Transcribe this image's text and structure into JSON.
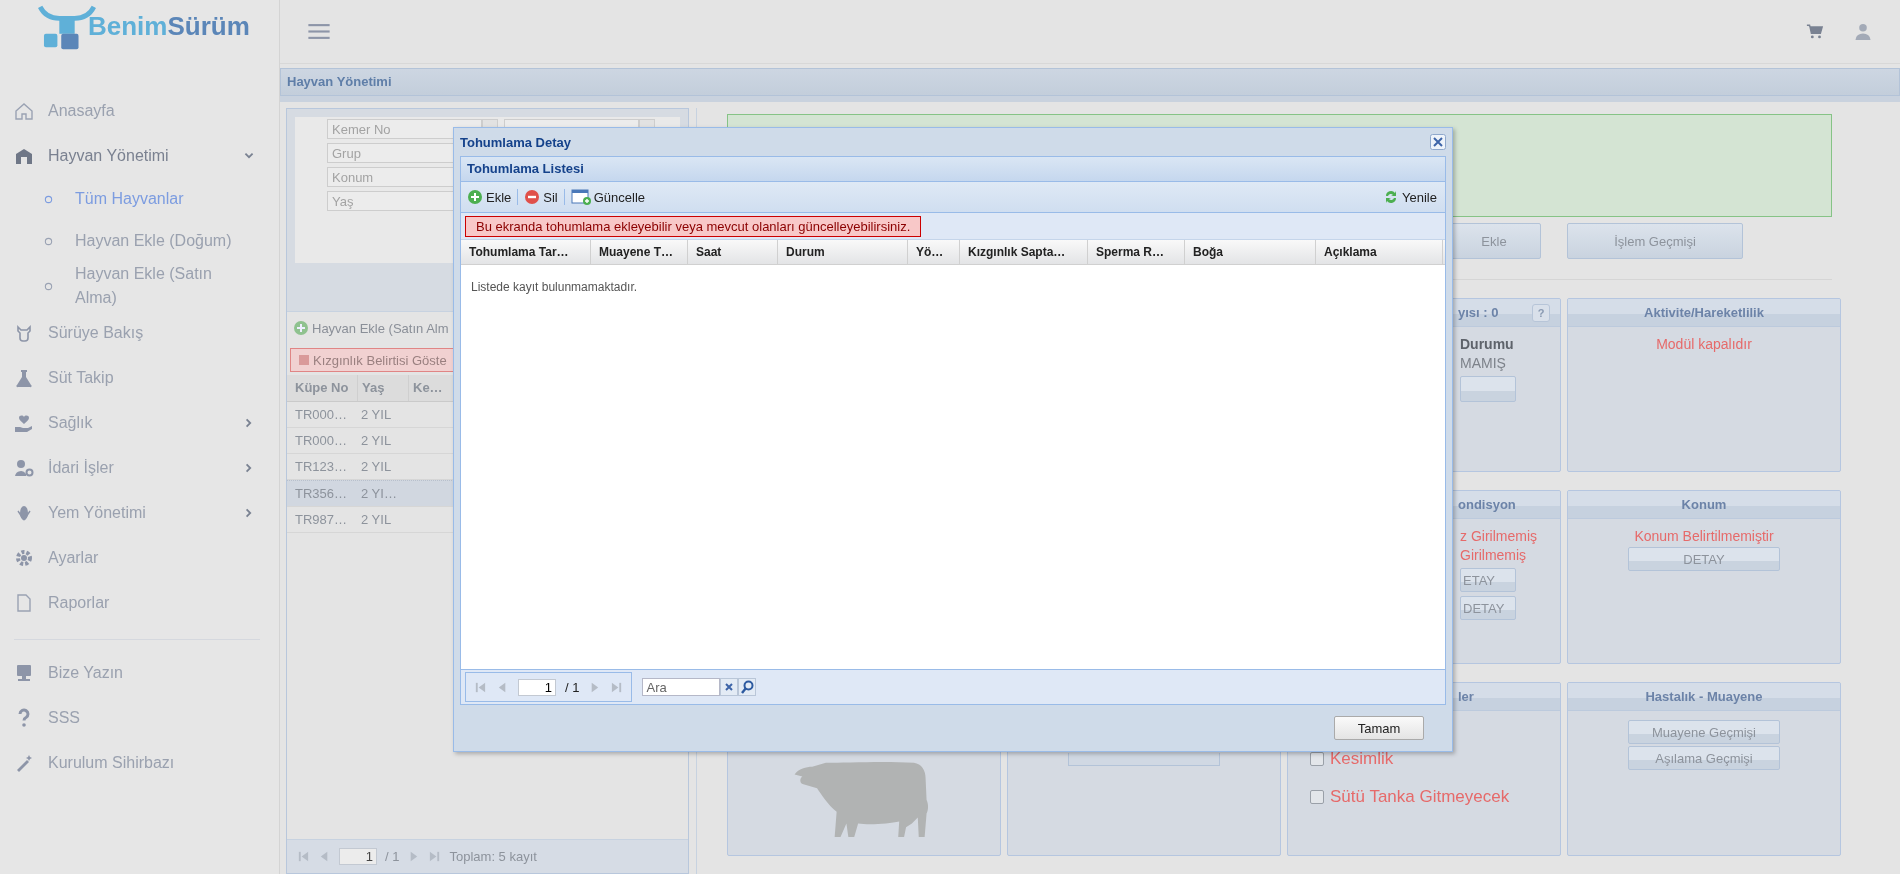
{
  "logo": {
    "parts": [
      "Benim",
      "Sürüm"
    ]
  },
  "sidebar": {
    "items": [
      {
        "label": "Anasayfa"
      },
      {
        "label": "Hayvan Yönetimi",
        "expanded": true,
        "children": [
          {
            "label": "Tüm Hayvanlar",
            "selected": true
          },
          {
            "label": "Hayvan Ekle (Doğum)",
            "selected": false
          },
          {
            "label": "Hayvan Ekle (Satın Alma)",
            "selected": false
          }
        ]
      },
      {
        "label": "Sürüye Bakış"
      },
      {
        "label": "Süt Takip"
      },
      {
        "label": "Sağlık",
        "expanded": false
      },
      {
        "label": "İdari İşler",
        "expanded": false
      },
      {
        "label": "Yem Yönetimi",
        "expanded": false
      },
      {
        "label": "Ayarlar"
      },
      {
        "label": "Raporlar"
      }
    ],
    "footer_items": [
      {
        "label": "Bize Yazın"
      },
      {
        "label": "SSS"
      },
      {
        "label": "Kurulum Sihirbazı"
      }
    ]
  },
  "page_header": "Hayvan Yönetimi",
  "filters": [
    {
      "placeholder": "Kemer No"
    },
    {
      "placeholder": "Grup"
    },
    {
      "placeholder": "Konum"
    },
    {
      "placeholder": "Yaş"
    }
  ],
  "animal_grid": {
    "toolbar_button": "Hayvan Ekle (Satın Alm",
    "filter_tag": "Kızgınlık Belirtisi Göste",
    "columns": [
      "Küpe No",
      "Yaş",
      "Ke…"
    ],
    "rows": [
      {
        "cells": [
          "TR000…",
          "2 YIL"
        ],
        "selected": false
      },
      {
        "cells": [
          "TR000…",
          "2 YIL"
        ],
        "selected": false
      },
      {
        "cells": [
          "TR123…",
          "2 YIL"
        ],
        "selected": false
      },
      {
        "cells": [
          "TR356…",
          "2 YI…"
        ],
        "selected": true
      },
      {
        "cells": [
          "TR987…",
          "2 YIL"
        ],
        "selected": false
      }
    ],
    "pager": {
      "page": "1",
      "total": "/ 1",
      "summary": "Toplam: 5 kayıt"
    }
  },
  "actions": [
    "Ekle",
    "İşlem Geçmişi"
  ],
  "cards": [
    {
      "kind": "clipped",
      "title": "yısı : 0",
      "help": "?",
      "lines": [
        {
          "text": "Durumu",
          "kind": "label"
        },
        {
          "text": "MAMIŞ",
          "kind": "value"
        }
      ],
      "button_stub": true
    },
    {
      "kind": "full",
      "title": "Aktivite/Hareketlilik",
      "lines": [
        {
          "text": "Modül kapalıdır",
          "kind": "warning"
        }
      ]
    },
    {
      "kind": "clipped",
      "title": "ondisyon",
      "lines": [
        {
          "text": "z Girilmemiş",
          "kind": "warning"
        },
        {
          "text": "Girilmemiş",
          "kind": "warning"
        }
      ],
      "buttons": [
        "ETAY",
        "DETAY"
      ]
    },
    {
      "kind": "full",
      "title": "Konum",
      "lines": [
        {
          "text": "Konum Belirtilmemiştir",
          "kind": "warning"
        }
      ],
      "buttons": [
        "DETAY"
      ]
    },
    {
      "kind": "cow"
    },
    {
      "kind": "lower",
      "button_stub": true
    },
    {
      "kind": "clipped",
      "title": "ler",
      "checks": [
        {
          "label": "Kesimlik",
          "checked": false
        },
        {
          "label": "Sütü Tanka Gitmeyecek",
          "checked": false
        }
      ]
    },
    {
      "kind": "full",
      "title": "Hastalık - Muayene",
      "buttons": [
        "Muayene Geçmişi",
        "Aşılama Geçmişi"
      ]
    }
  ],
  "dialog": {
    "title": "Tohumlama Detay",
    "panel_title": "Tohumlama Listesi",
    "toolbar": [
      {
        "label": "Ekle",
        "kind": "add"
      },
      {
        "label": "Sil",
        "kind": "delete"
      },
      {
        "label": "Güncelle",
        "kind": "edit"
      },
      {
        "label": "Yenile",
        "kind": "refresh"
      }
    ],
    "notice": "Bu ekranda tohumlama ekleyebilir veya mevcut olanları güncelleyebilirsiniz.",
    "columns": [
      "Tohumlama Tar…",
      "Muayene T…",
      "Saat",
      "Durum",
      "Yö…",
      "Kızgınlık Sapta…",
      "Sperma R…",
      "Boğa",
      "Açıklama"
    ],
    "empty_text": "Listede kayıt bulunmamaktadır.",
    "pager": {
      "page": "1",
      "total": "/ 1"
    },
    "search": {
      "placeholder": "Ara"
    },
    "ok_button": "Tamam"
  }
}
